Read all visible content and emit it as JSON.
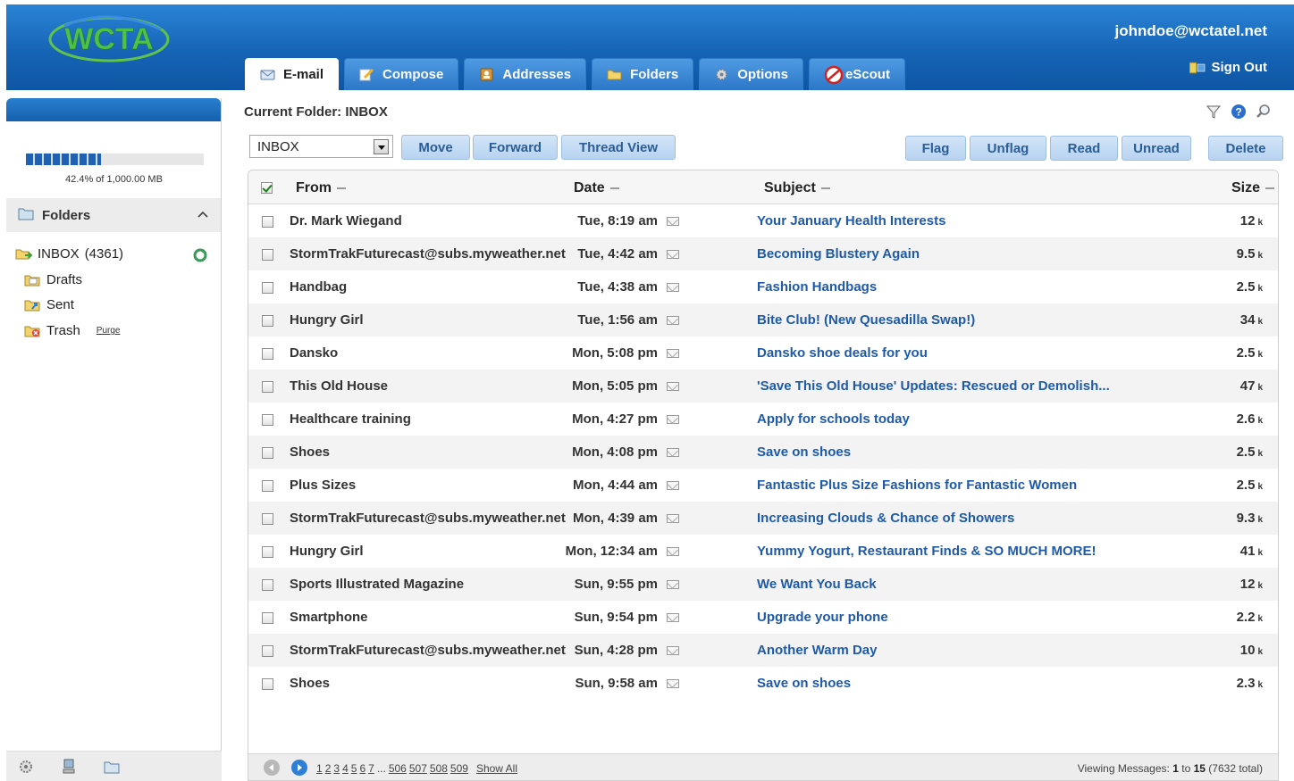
{
  "header": {
    "logo_text": "WCTA",
    "user_email": "johndoe@wctatel.net",
    "signout_label": "Sign Out",
    "tabs": [
      {
        "label": "E-mail",
        "icon": "email-icon",
        "active": true
      },
      {
        "label": "Compose",
        "icon": "compose-icon"
      },
      {
        "label": "Addresses",
        "icon": "addresses-icon"
      },
      {
        "label": "Folders",
        "icon": "folder-icon"
      },
      {
        "label": "Options",
        "icon": "gear-icon"
      },
      {
        "label": "eScout",
        "icon": "escout-icon"
      }
    ]
  },
  "sidebar": {
    "quota_fraction": 0.424,
    "quota_text": "42.4% of 1,000.00 MB",
    "folders_label": "Folders",
    "folders": [
      {
        "name": "INBOX",
        "count": "(4361)"
      },
      {
        "name": "Drafts"
      },
      {
        "name": "Sent"
      },
      {
        "name": "Trash",
        "action": "Purge"
      }
    ]
  },
  "main": {
    "current_folder": "Current Folder: INBOX",
    "folder_select_value": "INBOX",
    "buttons": {
      "move": "Move",
      "forward": "Forward",
      "thread_view": "Thread View",
      "flag": "Flag",
      "unflag": "Unflag",
      "read": "Read",
      "unread": "Unread",
      "delete": "Delete"
    },
    "columns": {
      "from": "From",
      "date": "Date",
      "subject": "Subject",
      "size": "Size"
    },
    "messages": [
      {
        "from": "Dr. Mark Wiegand",
        "date": "Tue, 8:19 am",
        "subject": "Your January Health Interests",
        "size": "12",
        "unit": "k"
      },
      {
        "from": "StormTrakFuturecast@subs.myweather.net",
        "date": "Tue, 4:42 am",
        "subject": "Becoming Blustery Again",
        "size": "9.5",
        "unit": "k"
      },
      {
        "from": "Handbag",
        "date": "Tue, 4:38 am",
        "subject": "Fashion Handbags",
        "size": "2.5",
        "unit": "k"
      },
      {
        "from": "Hungry Girl",
        "date": "Tue, 1:56 am",
        "subject": "Bite Club! (New Quesadilla Swap!)",
        "size": "34",
        "unit": "k"
      },
      {
        "from": "Dansko",
        "date": "Mon, 5:08 pm",
        "subject": "Dansko shoe deals for you",
        "size": "2.5",
        "unit": "k"
      },
      {
        "from": "This Old House",
        "date": "Mon, 5:05 pm",
        "subject": "'Save This Old House' Updates: Rescued or Demolish...",
        "size": "47",
        "unit": "k"
      },
      {
        "from": "Healthcare training",
        "date": "Mon, 4:27 pm",
        "subject": "Apply for schools today",
        "size": "2.6",
        "unit": "k"
      },
      {
        "from": "Shoes",
        "date": "Mon, 4:08 pm",
        "subject": "Save on shoes",
        "size": "2.5",
        "unit": "k"
      },
      {
        "from": "Plus Sizes",
        "date": "Mon, 4:44 am",
        "subject": "Fantastic Plus Size Fashions for Fantastic Women",
        "size": "2.5",
        "unit": "k"
      },
      {
        "from": "StormTrakFuturecast@subs.myweather.net",
        "date": "Mon, 4:39 am",
        "subject": "Increasing Clouds & Chance of Showers",
        "size": "9.3",
        "unit": "k"
      },
      {
        "from": "Hungry Girl",
        "date": "Mon, 12:34 am",
        "subject": "Yummy Yogurt, Restaurant Finds & SO MUCH MORE!",
        "size": "41",
        "unit": "k"
      },
      {
        "from": "Sports Illustrated Magazine",
        "date": "Sun, 9:55 pm",
        "subject": "We Want You Back",
        "size": "12",
        "unit": "k"
      },
      {
        "from": "Smartphone",
        "date": "Sun, 9:54 pm",
        "subject": "Upgrade your phone",
        "size": "2.2",
        "unit": "k"
      },
      {
        "from": "StormTrakFuturecast@subs.myweather.net",
        "date": "Sun, 4:28 pm",
        "subject": "Another Warm Day",
        "size": "10",
        "unit": "k"
      },
      {
        "from": "Shoes",
        "date": "Sun, 9:58 am",
        "subject": "Save on shoes",
        "size": "2.3",
        "unit": "k"
      }
    ],
    "pagination": {
      "pages": [
        "1",
        "2",
        "3",
        "4",
        "5",
        "6",
        "7",
        "...",
        "506",
        "507",
        "508",
        "509"
      ],
      "show_all": "Show All",
      "viewing_prefix": "Viewing Messages:",
      "viewing_from": "1",
      "viewing_to_word": "to",
      "viewing_to": "15",
      "viewing_total": "(7632 total)"
    }
  },
  "colors": {
    "header_blue": "#1664b6",
    "link_blue": "#1f5aa8",
    "button_bg": "#c6dcf4",
    "button_text": "#2b5d96"
  }
}
